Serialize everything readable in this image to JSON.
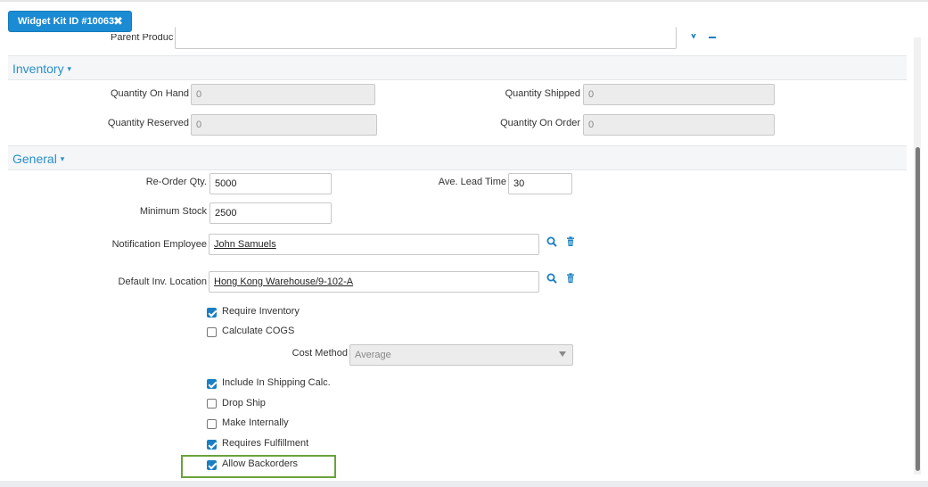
{
  "tab": {
    "title": "Widget Kit ID #10063",
    "close_glyph": "✖"
  },
  "parent_product": {
    "label": "Parent Product",
    "value": ""
  },
  "inventory": {
    "section_title": "Inventory",
    "caret": "▾",
    "qty_on_hand": {
      "label": "Quantity On Hand",
      "value": "0"
    },
    "qty_shipped": {
      "label": "Quantity Shipped",
      "value": "0"
    },
    "qty_reserved": {
      "label": "Quantity Reserved",
      "value": "0"
    },
    "qty_on_order": {
      "label": "Quantity On Order",
      "value": "0"
    }
  },
  "general": {
    "section_title": "General",
    "caret": "▾",
    "reorder_qty": {
      "label": "Re-Order Qty.",
      "value": "5000"
    },
    "ave_lead_time": {
      "label": "Ave. Lead Time",
      "value": "30"
    },
    "minimum_stock": {
      "label": "Minimum Stock",
      "value": "2500"
    },
    "notification_employee": {
      "label": "Notification Employee",
      "value": "John Samuels"
    },
    "default_inv_location": {
      "label": "Default Inv. Location",
      "value": "Hong Kong Warehouse/9-102-A"
    },
    "cost_method": {
      "label": "Cost Method",
      "value": "Average"
    },
    "checkboxes": {
      "require_inventory": {
        "label": "Require Inventory",
        "checked": true
      },
      "calculate_cogs": {
        "label": "Calculate COGS",
        "checked": false
      },
      "include_shipping": {
        "label": "Include In Shipping Calc.",
        "checked": true
      },
      "drop_ship": {
        "label": "Drop Ship",
        "checked": false
      },
      "make_internally": {
        "label": "Make Internally",
        "checked": false
      },
      "requires_fulfillment": {
        "label": "Requires Fulfillment",
        "checked": true
      },
      "allow_backorders": {
        "label": "Allow Backorders",
        "checked": true
      }
    }
  },
  "colors": {
    "accent": "#1b8bd4",
    "section_text": "#2a8fc9",
    "highlight": "#6aa23c"
  }
}
